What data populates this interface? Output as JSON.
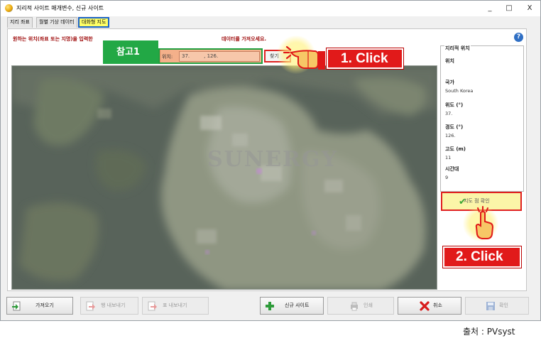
{
  "window": {
    "title": "지리적 사이트 매개변수, 신규 사이트",
    "controls": {
      "minimize": "_",
      "maximize": "□",
      "close": "X"
    }
  },
  "tabs": [
    {
      "label": "지리 좌표"
    },
    {
      "label": "월별 기상 데이터"
    },
    {
      "label": "대화형 지도",
      "active": true
    }
  ],
  "instruction": {
    "part1": "원하는 위치(좌표 또는 지명)을 입력한",
    "part2": "데이터를 가져오세요."
  },
  "location": {
    "label": "위치:",
    "value": "37.         , 126."
  },
  "find_button": {
    "label": "찾기"
  },
  "ref_badge": "참고1",
  "callouts": {
    "first": "1. Click",
    "second": "2. Click"
  },
  "map": {
    "watermark": "SUNERGY"
  },
  "geo_panel": {
    "legend": "지리적 위치",
    "location_label": "위치",
    "country_label": "국가",
    "country_value": "South Korea",
    "latitude_label": "위도 (°)",
    "latitude_value": "37.",
    "longitude_label": "경도 (°)",
    "longitude_value": "126.",
    "altitude_label": "고도 (m)",
    "altitude_value": "11",
    "timezone_label": "시간대",
    "timezone_value": "9"
  },
  "confirm_map_button": {
    "label": "지도 점 확인"
  },
  "bottom_buttons": {
    "import": "가져오기",
    "export_row": "행 내보내기",
    "export_table": "표 내보내기",
    "new_site": "신규 사이트",
    "print": "인쇄",
    "cancel": "취소",
    "ok": "확인"
  },
  "source_note": "출처 : PVsyst",
  "colors": {
    "callout_red": "#e11a1a",
    "badge_green": "#22a845",
    "active_tab_yellow": "#ffff66",
    "active_tab_border": "#1a63c7"
  }
}
